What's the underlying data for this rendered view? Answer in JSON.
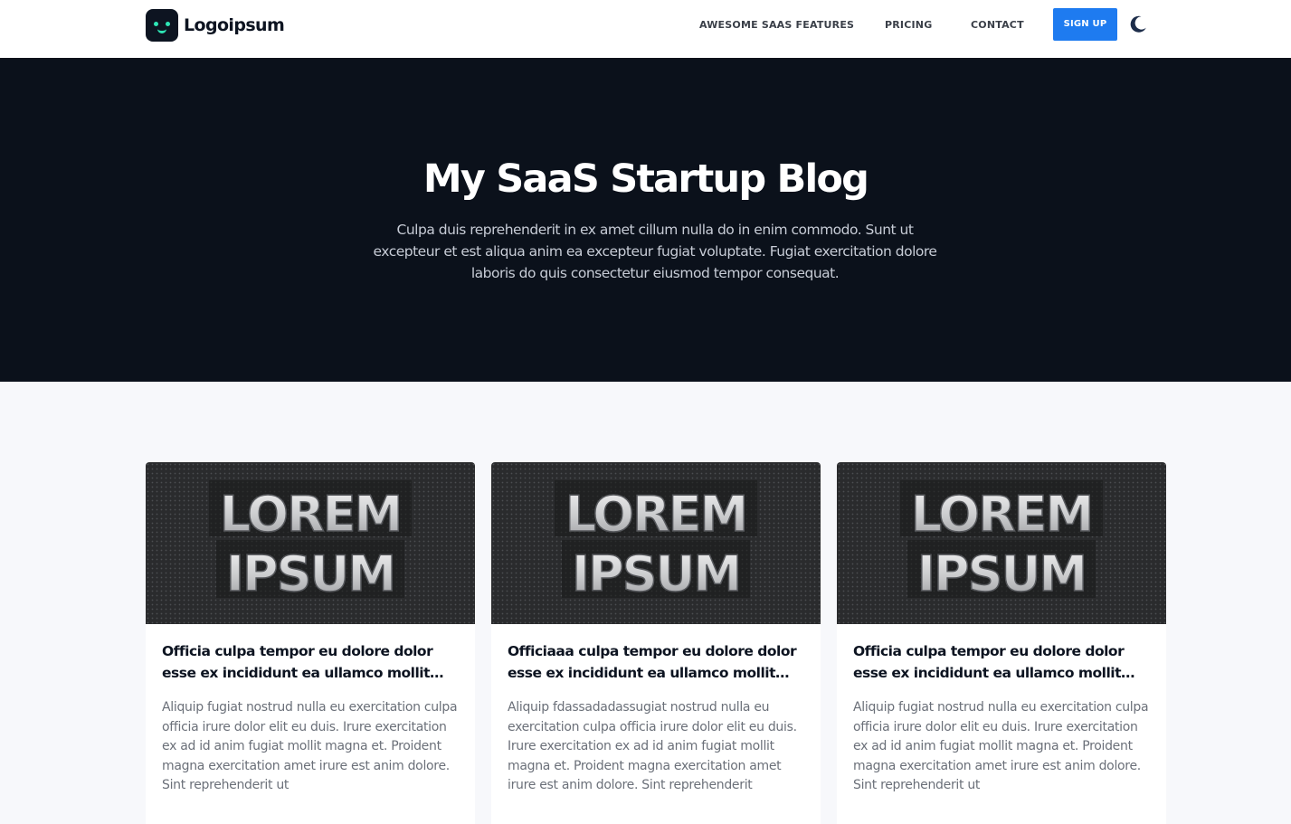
{
  "header": {
    "logo_text": "Logoipsum",
    "nav": [
      {
        "label": "AWESOME SAAS FEATURES"
      },
      {
        "label": "PRICING"
      },
      {
        "label": "CONTACT"
      }
    ],
    "signup_label": "SIGN UP",
    "theme_toggle_icon": "moon-icon"
  },
  "hero": {
    "title": "My SaaS Startup Blog",
    "description": "Culpa duis reprehenderit in ex amet cillum nulla do in enim commodo. Sunt ut excepteur et est aliqua anim ea excepteur fugiat voluptate. Fugiat exercitation dolore laboris do quis consectetur eiusmod tempor consequat."
  },
  "posts": [
    {
      "image_text": [
        "LOREM",
        "IPSUM"
      ],
      "title": "Officia culpa tempor eu dolore dolor esse ex incididunt ea ullamco mollit excepteur",
      "excerpt": "Aliquip fugiat nostrud nulla eu exercitation culpa officia irure dolor elit eu duis. Irure exercitation ex ad id anim fugiat mollit magna et. Proident magna exercitation amet irure est anim dolore. Sint reprehenderit ut"
    },
    {
      "image_text": [
        "LOREM",
        "IPSUM"
      ],
      "title": "Officiaaa culpa tempor eu dolore dolor esse ex incididunt ea ullamco mollit excepteur",
      "excerpt": "Aliquip fdassadadassugiat nostrud nulla eu exercitation culpa officia irure dolor elit eu duis. Irure exercitation ex ad id anim fugiat mollit magna et. Proident magna exercitation amet irure est anim dolore. Sint reprehenderit"
    },
    {
      "image_text": [
        "LOREM",
        "IPSUM"
      ],
      "title": "Officia culpa tempor eu dolore dolor esse ex incididunt ea ullamco mollit excepteur",
      "excerpt": "Aliquip fugiat nostrud nulla eu exercitation culpa officia irure dolor elit eu duis. Irure exercitation ex ad id anim fugiat mollit magna et. Proident magna exercitation amet irure est anim dolore. Sint reprehenderit ut"
    }
  ],
  "colors": {
    "accent": "#1e7bf0",
    "hero_bg": "#0b111b",
    "logo_accent": "#2ee6b6",
    "page_bg": "#f7f8fb"
  }
}
